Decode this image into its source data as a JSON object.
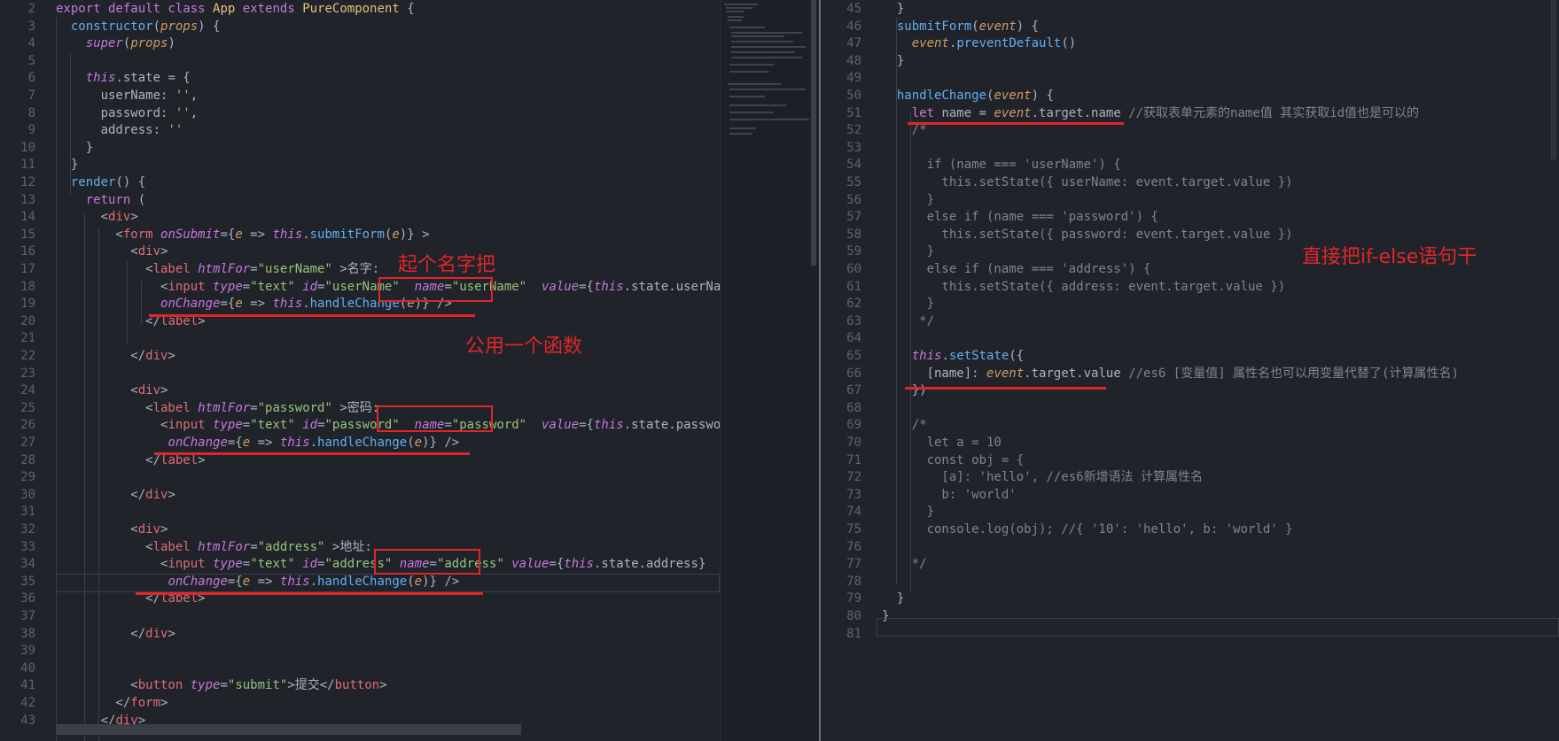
{
  "left_pane": {
    "lines": [
      {
        "n": "2",
        "html": "<span class=\"k\">export default class</span> <span class=\"p\">App</span> <span class=\"k\">extends</span> <span class=\"p\">PureComponent</span> {"
      },
      {
        "n": "3",
        "html": "  <span class=\"f\">constructor</span>(<span class=\"a\"><i>props</i></span>) {"
      },
      {
        "n": "4",
        "html": "    <span class=\"i\">super</span>(<span class=\"a\"><i>props</i></span>)"
      },
      {
        "n": "5",
        "html": ""
      },
      {
        "n": "6",
        "html": "    <span class=\"i\">this</span>.state = {"
      },
      {
        "n": "7",
        "html": "      userName: <span class=\"s\">''</span>,"
      },
      {
        "n": "8",
        "html": "      password: <span class=\"s\">''</span>,"
      },
      {
        "n": "9",
        "html": "      address: <span class=\"s\">''</span>"
      },
      {
        "n": "10",
        "html": "    }"
      },
      {
        "n": "11",
        "html": "  }"
      },
      {
        "n": "12",
        "html": "  <span class=\"f\">render</span>() {"
      },
      {
        "n": "13",
        "html": "    <span class=\"k\">return</span> ("
      },
      {
        "n": "14",
        "html": "      &lt;<span class=\"t\">div</span>&gt;"
      },
      {
        "n": "15",
        "html": "        &lt;<span class=\"t\">form</span> <span class=\"i\">onSubmit</span>={<span class=\"a\"><i>e</i></span> =&gt; <span class=\"i\">this</span>.<span class=\"f\">submitForm</span>(<span class=\"a\"><i>e</i></span>)} &gt;"
      },
      {
        "n": "16",
        "html": "          &lt;<span class=\"t\">div</span>&gt;"
      },
      {
        "n": "17",
        "html": "            &lt;<span class=\"t\">label</span> <span class=\"i\">htmlFor</span>=<span class=\"s\">\"userName\"</span> &gt;名字:"
      },
      {
        "n": "18",
        "html": "              &lt;<span class=\"t\">input</span> <span class=\"i\">type</span>=<span class=\"s\">\"text\"</span> <span class=\"i\">id</span>=<span class=\"s\">\"userName\"</span>  <span class=\"i\">name</span>=<span class=\"s\">\"userName\"</span>  <span class=\"i\">value</span>={<span class=\"i\">this</span>.state.userName}"
      },
      {
        "n": "19",
        "html": "              <span class=\"i\">onChange</span>={<span class=\"a\"><i>e</i></span> =&gt; <span class=\"i\">this</span>.<span class=\"f\">handleChange</span>(<span class=\"a\"><i>e</i></span>)} /&gt;"
      },
      {
        "n": "20",
        "html": "            &lt;/<span class=\"t\">label</span>&gt;"
      },
      {
        "n": "21",
        "html": ""
      },
      {
        "n": "22",
        "html": "          &lt;/<span class=\"t\">div</span>&gt;"
      },
      {
        "n": "23",
        "html": ""
      },
      {
        "n": "24",
        "html": "          &lt;<span class=\"t\">div</span>&gt;"
      },
      {
        "n": "25",
        "html": "            &lt;<span class=\"t\">label</span> <span class=\"i\">htmlFor</span>=<span class=\"s\">\"password\"</span> &gt;密码:"
      },
      {
        "n": "26",
        "html": "              &lt;<span class=\"t\">input</span> <span class=\"i\">type</span>=<span class=\"s\">\"text\"</span> <span class=\"i\">id</span>=<span class=\"s\">\"password\"</span>  <span class=\"i\">name</span>=<span class=\"s\">\"password\"</span>  <span class=\"i\">value</span>={<span class=\"i\">this</span>.state.password}"
      },
      {
        "n": "27",
        "html": "               <span class=\"i\">onChange</span>={<span class=\"a\"><i>e</i></span> =&gt; <span class=\"i\">this</span>.<span class=\"f\">handleChange</span>(<span class=\"a\"><i>e</i></span>)} /&gt;"
      },
      {
        "n": "28",
        "html": "            &lt;/<span class=\"t\">label</span>&gt;"
      },
      {
        "n": "29",
        "html": ""
      },
      {
        "n": "30",
        "html": "          &lt;/<span class=\"t\">div</span>&gt;"
      },
      {
        "n": "31",
        "html": ""
      },
      {
        "n": "32",
        "html": "          &lt;<span class=\"t\">div</span>&gt;"
      },
      {
        "n": "33",
        "html": "            &lt;<span class=\"t\">label</span> <span class=\"i\">htmlFor</span>=<span class=\"s\">\"address\"</span> &gt;地址:"
      },
      {
        "n": "34",
        "html": "              &lt;<span class=\"t\">input</span> <span class=\"i\">type</span>=<span class=\"s\">\"text\"</span> <span class=\"i\">id</span>=<span class=\"s\">\"address\"</span> <span class=\"i\">name</span>=<span class=\"s\">\"address\"</span> <span class=\"i\">value</span>={<span class=\"i\">this</span>.state.address}"
      },
      {
        "n": "35",
        "html": "               <span class=\"i\">onChange</span>={<span class=\"a\"><i>e</i></span> =&gt; <span class=\"i\">this</span>.<span class=\"f\">handleChange</span>(<span class=\"a\"><i>e</i></span>)} /&gt;"
      },
      {
        "n": "36",
        "html": "            &lt;/<span class=\"t\">label</span>&gt;"
      },
      {
        "n": "37",
        "html": ""
      },
      {
        "n": "38",
        "html": "          &lt;/<span class=\"t\">div</span>&gt;"
      },
      {
        "n": "39",
        "html": ""
      },
      {
        "n": "40",
        "html": ""
      },
      {
        "n": "41",
        "html": "          &lt;<span class=\"t\">button</span> <span class=\"i\">type</span>=<span class=\"s\">\"submit\"</span>&gt;提交&lt;/<span class=\"t\">button</span>&gt;"
      },
      {
        "n": "42",
        "html": "        &lt;/<span class=\"t\">form</span>&gt;"
      },
      {
        "n": "43",
        "html": "      &lt;/<span class=\"t\">div</span>&gt;"
      }
    ],
    "annotations": [
      "起个名字把",
      "公用一个函数"
    ]
  },
  "right_pane": {
    "lines": [
      {
        "n": "45",
        "html": "  }"
      },
      {
        "n": "46",
        "html": "  <span class=\"f\">submitForm</span>(<span class=\"a\"><i>event</i></span>) {"
      },
      {
        "n": "47",
        "html": "    <span class=\"a\"><i>event</i></span>.<span class=\"f\">preventDefault</span>()"
      },
      {
        "n": "48",
        "html": "  }"
      },
      {
        "n": "49",
        "html": ""
      },
      {
        "n": "50",
        "html": "  <span class=\"f\">handleChange</span>(<span class=\"a\"><i>event</i></span>) {"
      },
      {
        "n": "51",
        "html": "    <span class=\"k\">let</span> name = <span class=\"a\"><i>event</i></span>.target.name <span class=\"c\">//获取表单元素的name值 其实获取id值也是可以的</span>"
      },
      {
        "n": "52",
        "html": "    <span class=\"c\">/*</span>"
      },
      {
        "n": "53",
        "html": ""
      },
      {
        "n": "54",
        "html": "<span class=\"c\">      if (name === 'userName') {</span>"
      },
      {
        "n": "55",
        "html": "<span class=\"c\">        this.setState({ userName: event.target.value })</span>"
      },
      {
        "n": "56",
        "html": "<span class=\"c\">      }</span>"
      },
      {
        "n": "57",
        "html": "<span class=\"c\">      else if (name === 'password') {</span>"
      },
      {
        "n": "58",
        "html": "<span class=\"c\">        this.setState({ password: event.target.value })</span>"
      },
      {
        "n": "59",
        "html": "<span class=\"c\">      }</span>"
      },
      {
        "n": "60",
        "html": "<span class=\"c\">      else if (name === 'address') {</span>"
      },
      {
        "n": "61",
        "html": "<span class=\"c\">        this.setState({ address: event.target.value })</span>"
      },
      {
        "n": "62",
        "html": "<span class=\"c\">      }</span>"
      },
      {
        "n": "63",
        "html": "<span class=\"c\">     */</span>"
      },
      {
        "n": "64",
        "html": ""
      },
      {
        "n": "65",
        "html": "    <span class=\"i\">this</span>.<span class=\"f\">setState</span>({"
      },
      {
        "n": "66",
        "html": "      [name]: <span class=\"a\"><i>event</i></span>.target.value <span class=\"c\">//es6 [变量值] 属性名也可以用变量代替了(计算属性名)</span>"
      },
      {
        "n": "67",
        "html": "    })"
      },
      {
        "n": "68",
        "html": ""
      },
      {
        "n": "69",
        "html": "    <span class=\"c\">/*</span>"
      },
      {
        "n": "70",
        "html": "<span class=\"c\">      let a = 10</span>"
      },
      {
        "n": "71",
        "html": "<span class=\"c\">      const obj = {</span>"
      },
      {
        "n": "72",
        "html": "<span class=\"c\">        [a]: 'hello', //es6新增语法 计算属性名</span>"
      },
      {
        "n": "73",
        "html": "<span class=\"c\">        b: 'world'</span>"
      },
      {
        "n": "74",
        "html": "<span class=\"c\">      }</span>"
      },
      {
        "n": "75",
        "html": "<span class=\"c\">      console.log(obj); //{ '10': 'hello', b: 'world' }</span>"
      },
      {
        "n": "76",
        "html": ""
      },
      {
        "n": "77",
        "html": "<span class=\"c\">    */</span>"
      },
      {
        "n": "78",
        "html": ""
      },
      {
        "n": "79",
        "html": "  }"
      },
      {
        "n": "80",
        "html": "}"
      },
      {
        "n": "81",
        "html": ""
      }
    ],
    "annotations": [
      "直接把if-else语句干"
    ]
  }
}
